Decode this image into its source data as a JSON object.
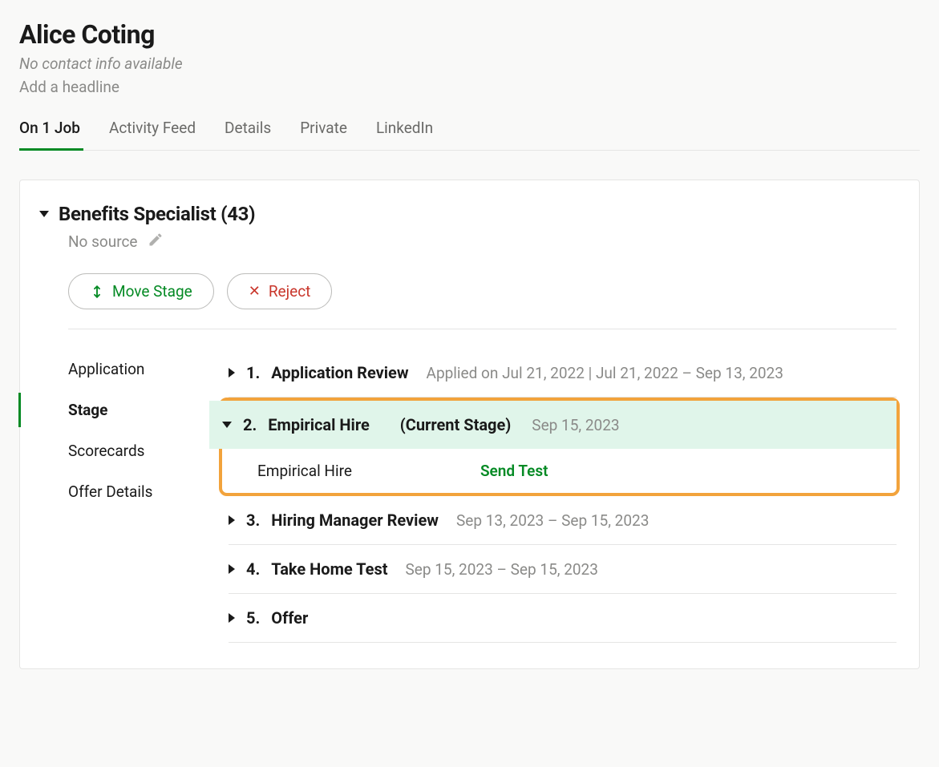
{
  "candidate": {
    "name": "Alice Coting",
    "contact_info": "No contact info available",
    "headline_placeholder": "Add a headline"
  },
  "tabs": [
    {
      "label": "On 1 Job",
      "active": true
    },
    {
      "label": "Activity Feed",
      "active": false
    },
    {
      "label": "Details",
      "active": false
    },
    {
      "label": "Private",
      "active": false
    },
    {
      "label": "LinkedIn",
      "active": false
    }
  ],
  "job": {
    "title": "Benefits Specialist (43)",
    "source": "No source"
  },
  "actions": {
    "move_stage": "Move Stage",
    "reject": "Reject"
  },
  "sidebar": {
    "items": [
      {
        "label": "Application",
        "active": false
      },
      {
        "label": "Stage",
        "active": true
      },
      {
        "label": "Scorecards",
        "active": false
      },
      {
        "label": "Offer Details",
        "active": false
      }
    ]
  },
  "stages": [
    {
      "number": "1.",
      "name": "Application Review",
      "meta": "Applied on Jul 21, 2022 | Jul 21, 2022 – Sep 13, 2023"
    },
    {
      "number": "2.",
      "name": "Empirical Hire",
      "current_label": "(Current Stage)",
      "date": "Sep 15, 2023",
      "sub_name": "Empirical Hire",
      "sub_action": "Send Test"
    },
    {
      "number": "3.",
      "name": "Hiring Manager Review",
      "meta": "Sep 13, 2023 – Sep 15, 2023"
    },
    {
      "number": "4.",
      "name": "Take Home Test",
      "meta": "Sep 15, 2023 – Sep 15, 2023"
    },
    {
      "number": "5.",
      "name": "Offer",
      "meta": ""
    }
  ]
}
